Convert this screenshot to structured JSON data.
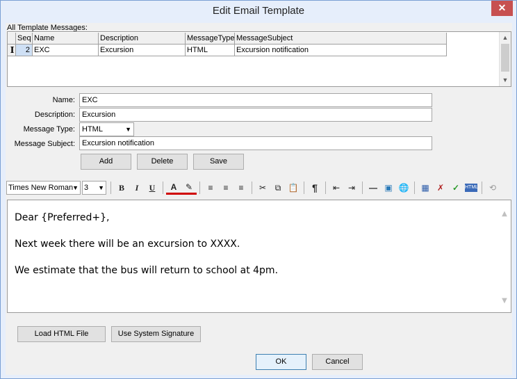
{
  "window": {
    "title": "Edit Email Template",
    "close_glyph": "✕"
  },
  "grid": {
    "label": "All Template Messages:",
    "columns": [
      "Seq",
      "Name",
      "Description",
      "MessageType",
      "MessageSubject"
    ],
    "rows": [
      {
        "indicator": "I",
        "seq": "2",
        "name": "EXC",
        "description": "Excursion",
        "type": "HTML",
        "subject": "Excursion notification"
      }
    ]
  },
  "form": {
    "name_label": "Name:",
    "name_value": "EXC",
    "description_label": "Description:",
    "description_value": "Excursion",
    "type_label": "Message Type:",
    "type_value": "HTML",
    "subject_label": "Message Subject:",
    "subject_value": "Excursion notification",
    "add_label": "Add",
    "delete_label": "Delete",
    "save_label": "Save"
  },
  "toolbar": {
    "font_name": "Times New Roman",
    "font_size": "3",
    "icons": [
      "bold-icon",
      "italic-icon",
      "underline-icon",
      "font-color-icon",
      "highlight-icon",
      "align-left-icon",
      "align-center-icon",
      "align-right-icon",
      "cut-icon",
      "copy-icon",
      "paste-icon",
      "paragraph-icon",
      "outdent-icon",
      "indent-icon",
      "horizontal-rule-icon",
      "insert-image-icon",
      "insert-link-icon",
      "insert-table-icon",
      "remove-format-icon",
      "spellcheck-icon",
      "html-source-icon",
      "undo-icon"
    ]
  },
  "editor": {
    "lines": [
      "Dear {Preferred+},",
      "Next week there will be an excursion to XXXX.",
      "We estimate that the bus will return to school at 4pm."
    ]
  },
  "footer": {
    "load_html_label": "Load HTML File",
    "system_signature_label": "Use System Signature",
    "ok_label": "OK",
    "cancel_label": "Cancel"
  },
  "colors": {
    "title_bar": "#e6eefb",
    "close_button": "#c75050",
    "selected_cell": "#cfe0f5"
  }
}
